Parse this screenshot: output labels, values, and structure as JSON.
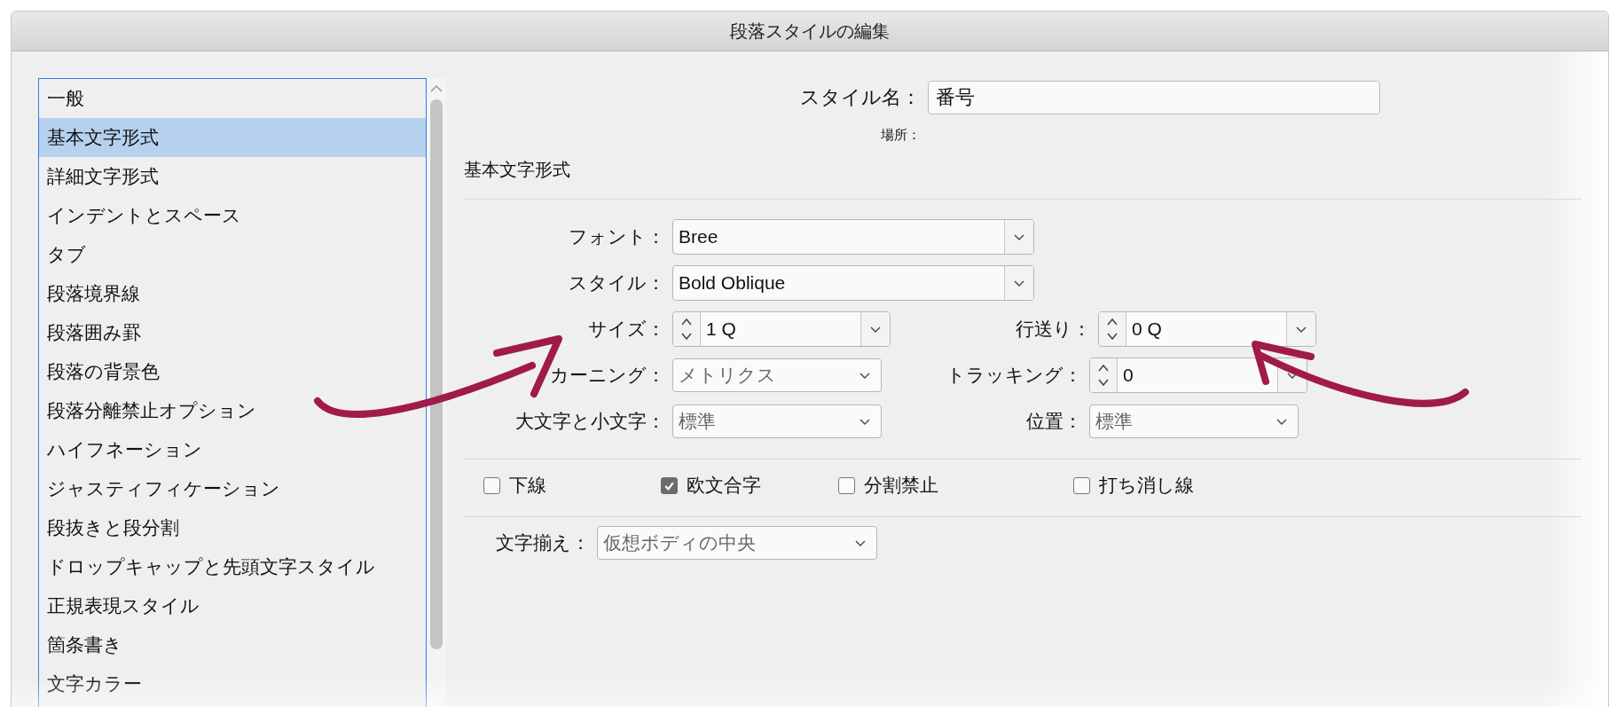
{
  "window": {
    "title": "段落スタイルの編集"
  },
  "sidebar": {
    "items": [
      {
        "label": "一般",
        "selected": false
      },
      {
        "label": "基本文字形式",
        "selected": true
      },
      {
        "label": "詳細文字形式",
        "selected": false
      },
      {
        "label": "インデントとスペース",
        "selected": false
      },
      {
        "label": "タブ",
        "selected": false
      },
      {
        "label": "段落境界線",
        "selected": false
      },
      {
        "label": "段落囲み罫",
        "selected": false
      },
      {
        "label": "段落の背景色",
        "selected": false
      },
      {
        "label": "段落分離禁止オプション",
        "selected": false
      },
      {
        "label": "ハイフネーション",
        "selected": false
      },
      {
        "label": "ジャスティフィケーション",
        "selected": false
      },
      {
        "label": "段抜きと段分割",
        "selected": false
      },
      {
        "label": "ドロップキャップと先頭文字スタイル",
        "selected": false
      },
      {
        "label": "正規表現スタイル",
        "selected": false
      },
      {
        "label": "箇条書き",
        "selected": false
      },
      {
        "label": "文字カラー",
        "selected": false
      }
    ]
  },
  "style_name": {
    "label": "スタイル名：",
    "value": "番号"
  },
  "location": {
    "label": "場所："
  },
  "section_title": "基本文字形式",
  "rows": [
    [
      {
        "label": "フォント：",
        "kind": "combo",
        "value": "Bree"
      }
    ],
    [
      {
        "label": "スタイル：",
        "kind": "combo",
        "value": "Bold Oblique"
      }
    ],
    [
      {
        "label": "サイズ：",
        "kind": "stepper",
        "value": "1 Q"
      },
      {
        "label": "行送り：",
        "kind": "stepper",
        "value": "0 Q"
      }
    ],
    [
      {
        "label": "カーニング：",
        "kind": "select",
        "value": "メトリクス"
      },
      {
        "label": "トラッキング：",
        "kind": "stepper",
        "value": "0"
      }
    ],
    [
      {
        "label": "大文字と小文字：",
        "kind": "select",
        "value": "標準"
      },
      {
        "label": "位置：",
        "kind": "select",
        "value": "標準"
      }
    ]
  ],
  "checkboxes": [
    {
      "label": "下線",
      "checked": false
    },
    {
      "label": "欧文合字",
      "checked": true
    },
    {
      "label": "分割禁止",
      "checked": false
    },
    {
      "label": "打ち消し線",
      "checked": false
    }
  ],
  "alignment": {
    "label": "文字揃え：",
    "value": "仮想ボディの中央"
  }
}
